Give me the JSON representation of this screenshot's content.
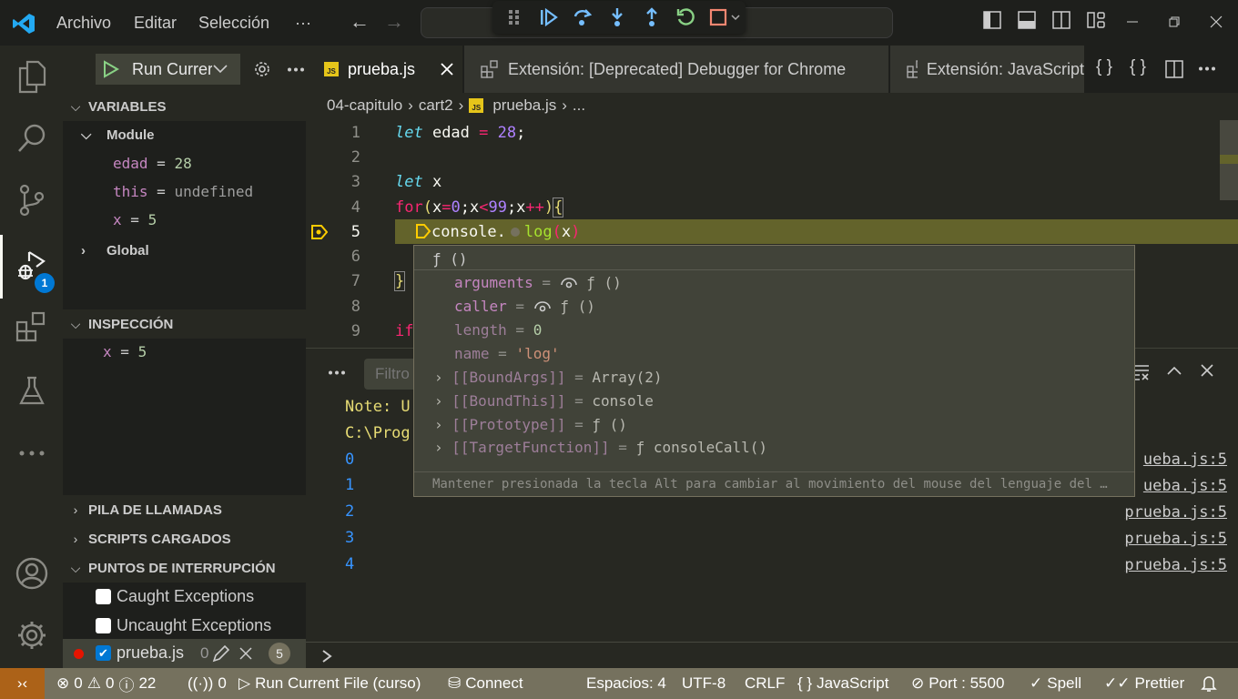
{
  "titlebar": {
    "menu": [
      "Archivo",
      "Editar",
      "Selección",
      "···"
    ],
    "debug_toolbar": [
      "drag-handle",
      "continue",
      "step-over",
      "step-into",
      "step-out",
      "restart",
      "stop"
    ]
  },
  "activity_bar": {
    "items": [
      "explorer",
      "search",
      "source-control",
      "run-and-debug",
      "extensions",
      "testing",
      "more"
    ],
    "debug_badge": "1"
  },
  "sidebar": {
    "run_config": "Run Currer",
    "variables_header": "VARIABLES",
    "module_label": "Module",
    "variables": [
      {
        "name": "edad",
        "eq": "=",
        "value": "28"
      },
      {
        "name": "this",
        "eq": "=",
        "value": "undefined"
      },
      {
        "name": "x",
        "eq": "=",
        "value": "5"
      }
    ],
    "global_label": "Global",
    "watch_header": "INSPECCIÓN",
    "watch": {
      "name": "x",
      "eq": "=",
      "value": "5"
    },
    "callstack_header": "PILA DE LLAMADAS",
    "scripts_header": "SCRIPTS CARGADOS",
    "breakpoints_header": "PUNTOS DE INTERRUPCIÓN",
    "breakpoints": [
      {
        "label": "Caught Exceptions",
        "checked": false
      },
      {
        "label": "Uncaught Exceptions",
        "checked": false
      },
      {
        "label": "prueba.js",
        "checked": true,
        "extra": "0",
        "line": "5"
      }
    ]
  },
  "tabs": [
    {
      "label": "prueba.js",
      "active": true
    },
    {
      "label": "Extensión: [Deprecated] Debugger for Chrome",
      "active": false
    },
    {
      "label": "Extensión: JavaScript",
      "active": false
    }
  ],
  "breadcrumb": [
    "04-capitulo",
    "cart2",
    "prueba.js",
    "..."
  ],
  "editor": {
    "line_numbers": [
      "1",
      "2",
      "3",
      "4",
      "5",
      "6",
      "7",
      "8",
      "9"
    ],
    "current_line": "5"
  },
  "hover": {
    "header": "ƒ ()",
    "props": [
      {
        "name": "arguments",
        "value": "ƒ ()"
      },
      {
        "name": "caller",
        "value": "ƒ ()"
      },
      {
        "name": "length",
        "value": "0"
      },
      {
        "name": "name",
        "value": "'log'"
      },
      {
        "name": "[[BoundArgs]]",
        "value": "Array(2)"
      },
      {
        "name": "[[BoundThis]]",
        "value": "console"
      },
      {
        "name": "[[Prototype]]",
        "value": "ƒ ()"
      },
      {
        "name": "[[TargetFunction]]",
        "value": "ƒ consoleCall()"
      }
    ],
    "footer": "Mantener presionada la tecla Alt para cambiar al movimiento del mouse del lenguaje del …"
  },
  "panel": {
    "filter_placeholder": "Filtro",
    "output": [
      "Note: U",
      "C:\\Prog",
      "0",
      "1",
      "2",
      "3",
      "4"
    ],
    "links": [
      "ueba.js:5",
      "ueba.js:5",
      "prueba.js:5",
      "prueba.js:5",
      "prueba.js:5"
    ]
  },
  "statusbar": {
    "errors": "0",
    "warnings": "0",
    "infos": "22",
    "ports": "0",
    "debug": "Run Current File (curso)",
    "connect": "Connect",
    "spaces": "Espacios: 4",
    "encoding": "UTF-8",
    "eol": "CRLF",
    "language": "JavaScript",
    "port": "Port : 5500",
    "spell": "Spell",
    "prettier": "Prettier"
  }
}
